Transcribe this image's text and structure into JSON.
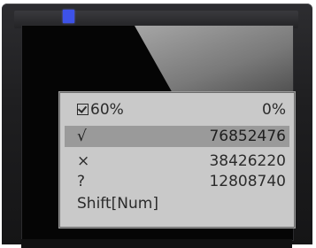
{
  "status": {
    "checkbox_percent": "60%",
    "right_percent": "0%"
  },
  "rows": [
    {
      "symbol": "√",
      "value": "76852476"
    },
    {
      "symbol": "×",
      "value": "38426220"
    },
    {
      "symbol": "?",
      "value": "12808740"
    }
  ],
  "footer": {
    "label": "Shift[Num]"
  },
  "colors": {
    "led": "#3d52e8",
    "panel_bg": "#c9c9c9",
    "selected_row_bg": "#9a9a9a"
  }
}
